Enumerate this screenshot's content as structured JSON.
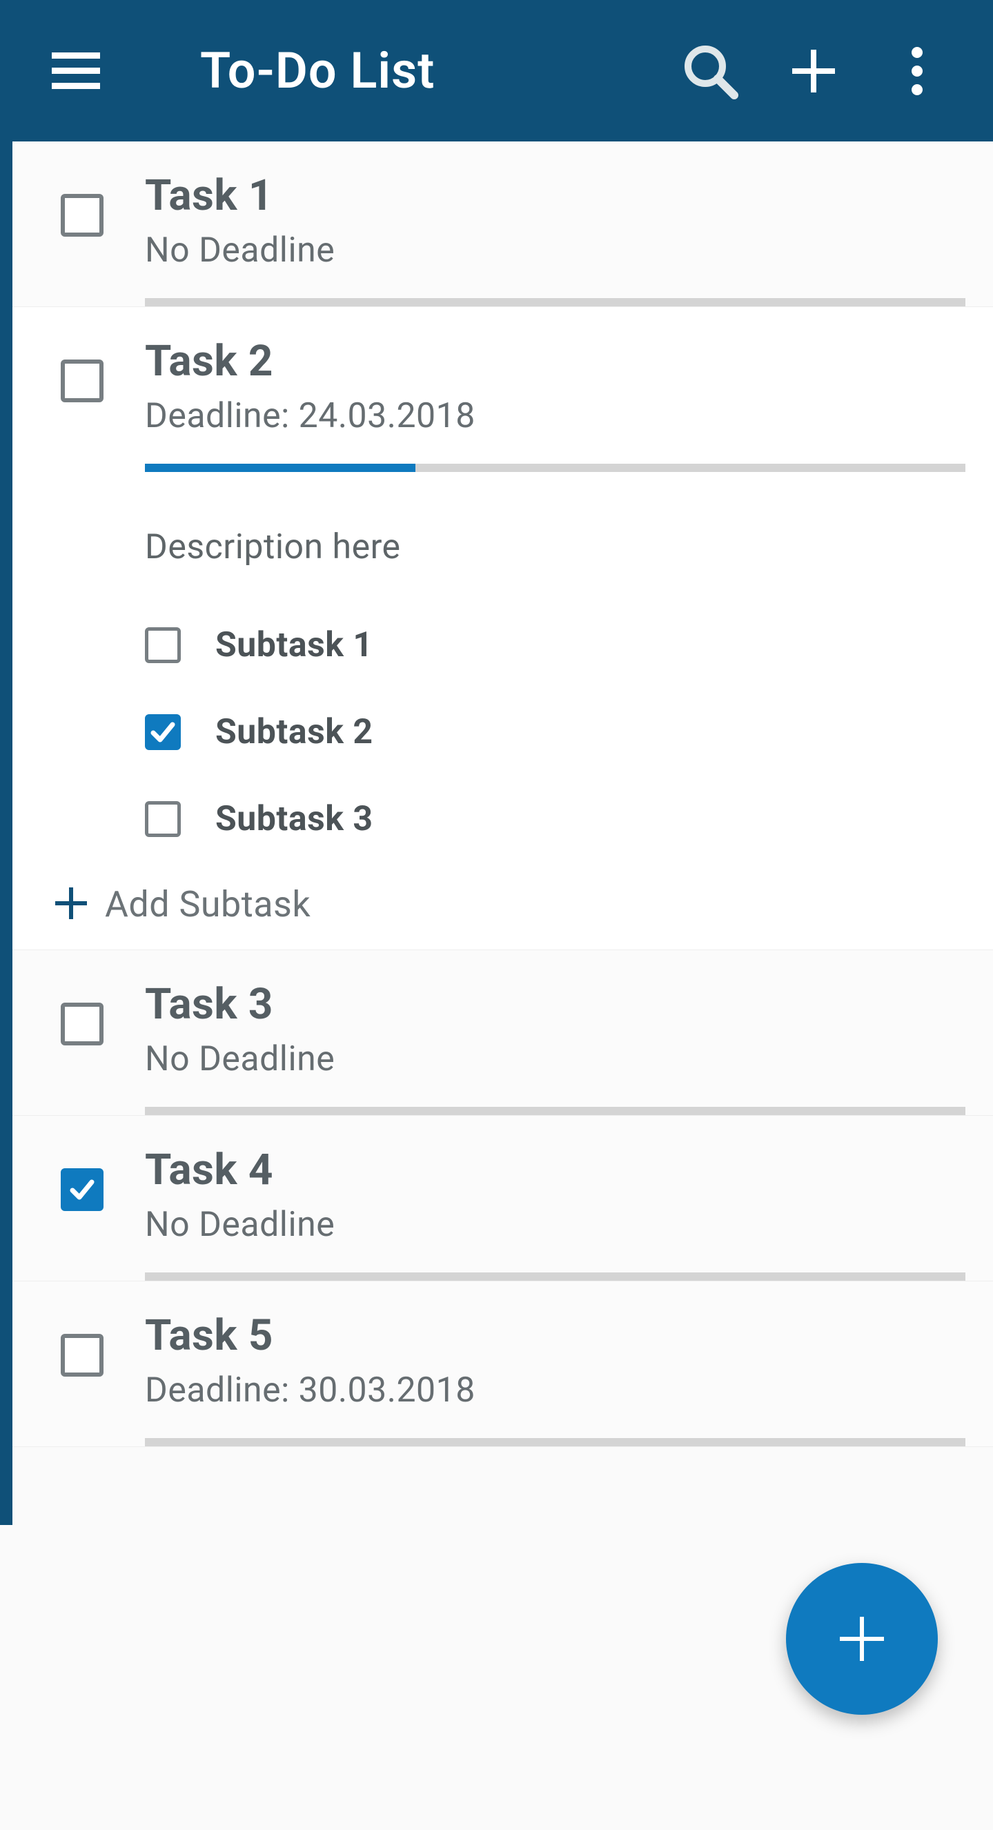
{
  "appbar": {
    "title": "To-Do List"
  },
  "addSubtaskLabel": "Add Subtask",
  "tasks": [
    {
      "title": "Task 1",
      "subtitle": "No Deadline",
      "checked": false,
      "progress": 0,
      "expanded": false
    },
    {
      "title": "Task 2",
      "subtitle": "Deadline: 24.03.2018",
      "checked": false,
      "progress": 33,
      "expanded": true,
      "description": "Description here",
      "subtasks": [
        {
          "label": "Subtask 1",
          "checked": false
        },
        {
          "label": "Subtask 2",
          "checked": true
        },
        {
          "label": "Subtask 3",
          "checked": false
        }
      ]
    },
    {
      "title": "Task 3",
      "subtitle": "No Deadline",
      "checked": false,
      "progress": 0,
      "expanded": false
    },
    {
      "title": "Task 4",
      "subtitle": "No Deadline",
      "checked": true,
      "progress": 0,
      "expanded": false
    },
    {
      "title": "Task 5",
      "subtitle": "Deadline: 30.03.2018",
      "checked": false,
      "progress": 0,
      "expanded": false
    }
  ]
}
